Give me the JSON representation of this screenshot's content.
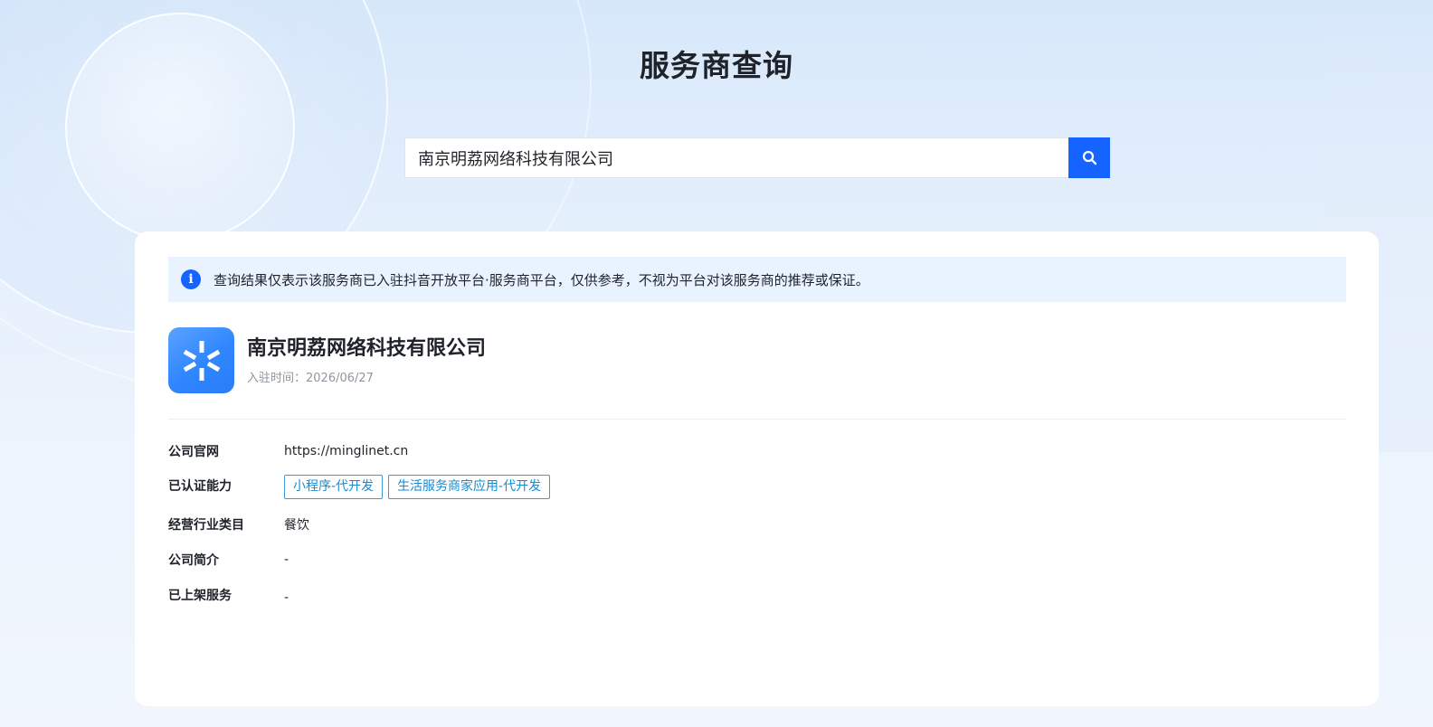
{
  "page": {
    "title": "服务商查询"
  },
  "search": {
    "value": "南京明荔网络科技有限公司",
    "button_icon": "search-icon"
  },
  "notice": {
    "icon": "info-icon",
    "text": "查询结果仅表示该服务商已入驻抖音开放平台·服务商平台，仅供参考，不视为平台对该服务商的推荐或保证。"
  },
  "company": {
    "name": "南京明荔网络科技有限公司",
    "join_label": "入驻时间：",
    "join_date": "2026/06/27",
    "logo_icon": "asterisk-logo-icon"
  },
  "details": {
    "website_label": "公司官网",
    "website_value": "https://minglinet.cn",
    "certified_label": "已认证能力",
    "certified_tags": [
      "小程序-代开发",
      "生活服务商家应用-代开发"
    ],
    "industry_label": "经营行业类目",
    "industry_value": "餐饮",
    "intro_label": "公司简介",
    "intro_value": "-",
    "services_label": "已上架服务",
    "services_value": "-"
  },
  "colors": {
    "brand_blue": "#1664ff",
    "notice_bg": "#e8f3ff",
    "tag_border": "#3a9bd5",
    "tag_text": "#1a8acc"
  }
}
